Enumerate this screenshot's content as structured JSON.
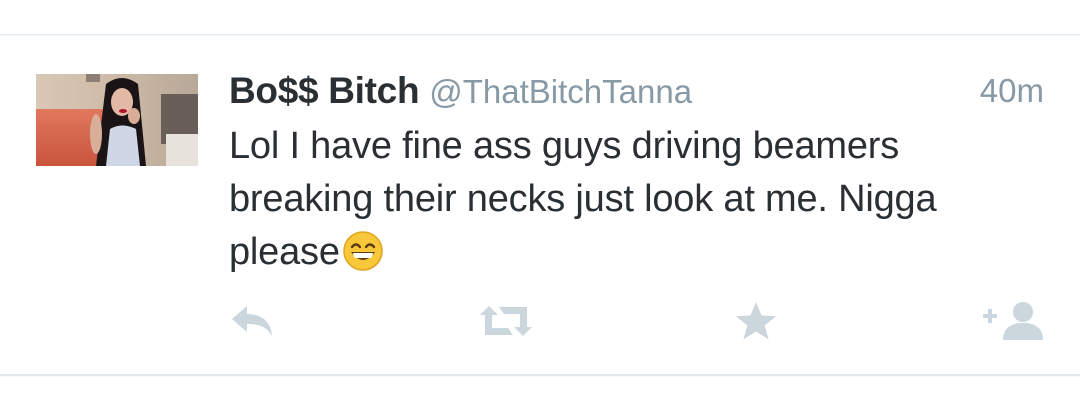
{
  "tweet": {
    "display_name": "Bo$$ Bitch",
    "handle": "@ThatBitchTanna",
    "timestamp": "40m",
    "text_lines": [
      "Lol I have fine ass guys driving beamers",
      "breaking their necks just look at me. Nigga",
      "please"
    ],
    "emoji": "grinning-face-emoji"
  },
  "actions": {
    "reply": "reply-icon",
    "retweet": "retweet-icon",
    "favorite": "star-icon",
    "follow": "add-user-icon"
  },
  "colors": {
    "text": "#292f33",
    "muted": "#8899a6",
    "icon": "#ccd6dd",
    "divider": "#e1e8ed"
  }
}
